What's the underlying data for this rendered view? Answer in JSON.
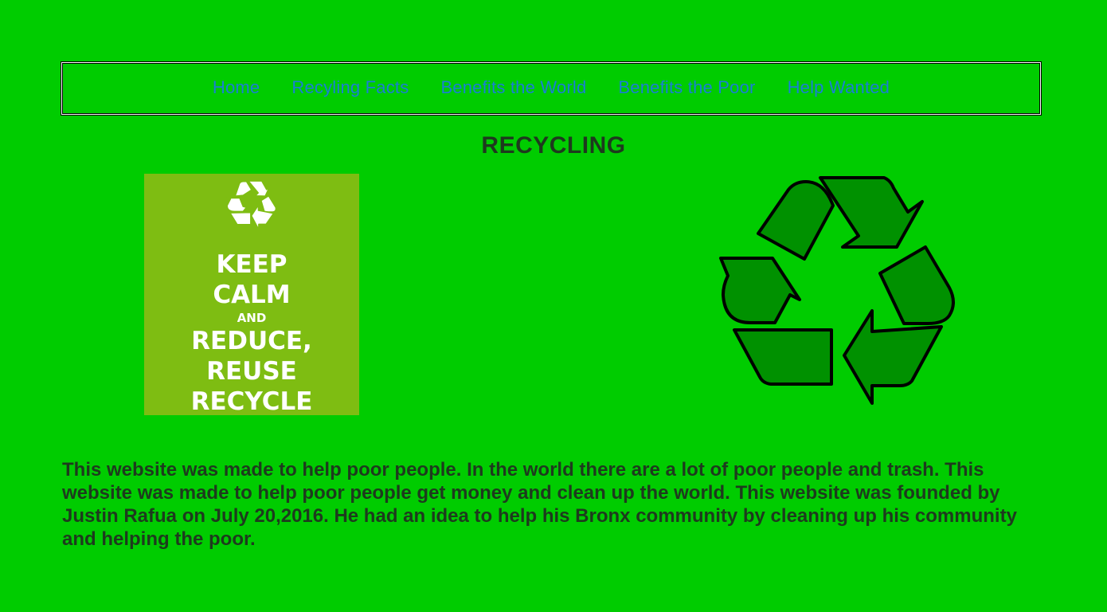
{
  "nav": {
    "items": [
      "Home",
      "Recyling Facts",
      "Benefits the World",
      "Benefits the Poor",
      "Help Wanted"
    ]
  },
  "title": "RECYCLING",
  "poster": {
    "line1": "KEEP",
    "line2": "CALM",
    "line3": "AND",
    "line4": "REDUCE, REUSE",
    "line5": "RECYCLE",
    "icon": "recycle-icon"
  },
  "logo": {
    "icon": "recycle-symbol-icon"
  },
  "about": "This website was made to help poor people. In the world there are a lot of poor people and trash. This website was made to help poor people get money and clean up the world. This website was founded by Justin Rafua on July 20,2016. He had an idea to help his Bronx community by cleaning up his community and helping the poor.",
  "colors": {
    "background": "#00cc00",
    "nav_link": "#1a7fd4",
    "poster_bg": "#7ebd12",
    "logo_fill": "#009100"
  }
}
